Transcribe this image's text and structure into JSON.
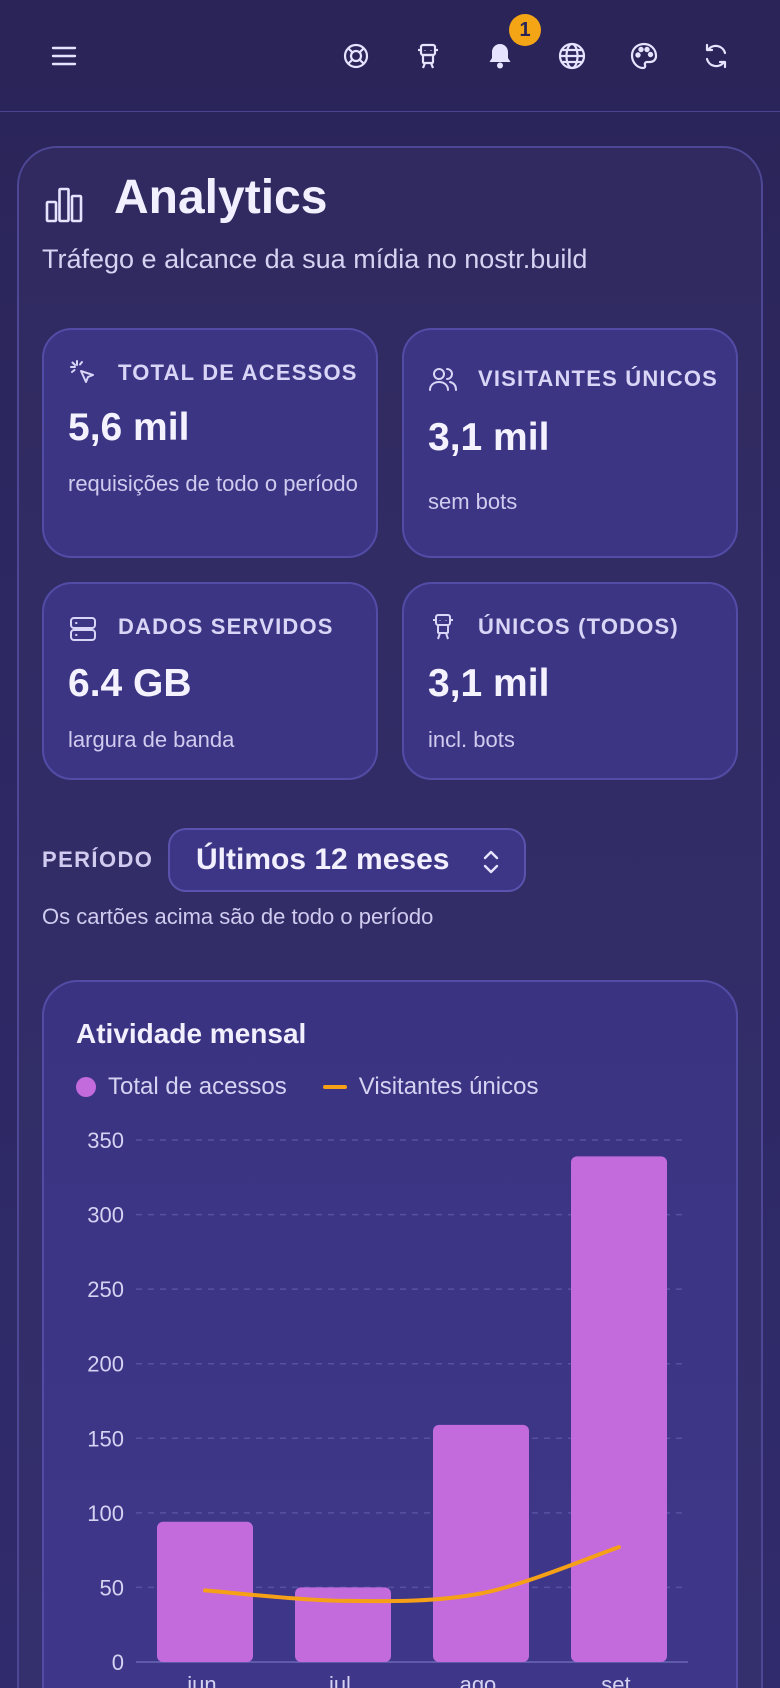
{
  "topbar": {
    "icons": [
      "menu-icon",
      "lifebuoy-icon",
      "robot-icon",
      "bell-icon",
      "globe-icon",
      "palette-icon",
      "refresh-icon"
    ],
    "notification_count": "1"
  },
  "header": {
    "title": "Analytics",
    "subtitle": "Tráfego e alcance da sua mídia no nostr.build"
  },
  "stats": [
    {
      "icon": "pointer-click-icon",
      "label": "TOTAL DE ACESSOS",
      "value": "5,6 mil",
      "desc": "requisições de todo o período"
    },
    {
      "icon": "users-icon",
      "label": "VISITANTES ÚNICOS",
      "value": "3,1 mil",
      "desc": "sem bots"
    },
    {
      "icon": "server-icon",
      "label": "DADOS SERVIDOS",
      "value": "6.4 GB",
      "desc": "largura de banda"
    },
    {
      "icon": "robot-icon",
      "label": "ÚNICOS (TODOS)",
      "value": "3,1 mil",
      "desc": "incl. bots"
    }
  ],
  "period": {
    "label": "PERÍODO",
    "selected": "Últimos 12 meses",
    "note": "Os cartões acima são de todo o período"
  },
  "chart_data": {
    "type": "bar",
    "title": "Atividade mensal",
    "categories": [
      "jun.",
      "jul.",
      "ago.",
      "set."
    ],
    "series": [
      {
        "name": "Total de acessos",
        "type": "bar",
        "values": [
          94,
          50,
          159,
          339
        ]
      },
      {
        "name": "Visitantes únicos",
        "type": "line",
        "values": [
          48,
          41,
          46,
          77
        ]
      }
    ],
    "y_ticks": [
      0,
      50,
      100,
      150,
      200,
      250,
      300,
      350
    ],
    "ylim": [
      0,
      350
    ],
    "grid": true,
    "legend": "top-left",
    "colors": {
      "bar": "#c36bdd",
      "line": "#f5a016"
    }
  }
}
